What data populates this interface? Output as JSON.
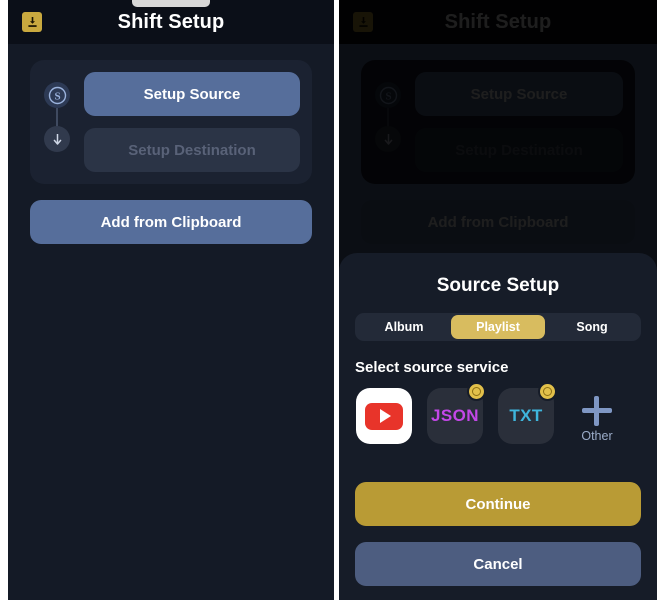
{
  "app": {
    "title": "Shift Setup",
    "import_icon": "download-tray-icon"
  },
  "setup": {
    "source_node_icon": "source-circle-s-icon",
    "destination_node_icon": "arrow-down-circle-icon",
    "source_button": "Setup Source",
    "destination_button": "Setup Destination",
    "clipboard_button": "Add from Clipboard"
  },
  "sheet": {
    "title": "Source Setup",
    "segments": [
      {
        "label": "Album",
        "active": false
      },
      {
        "label": "Playlist",
        "active": true
      },
      {
        "label": "Song",
        "active": false
      }
    ],
    "section_label": "Select source service",
    "services": [
      {
        "label": "",
        "kind": "youtube",
        "badge": false,
        "icon": "youtube-icon"
      },
      {
        "label": "JSON",
        "kind": "json",
        "badge": true,
        "icon": "json-file-icon"
      },
      {
        "label": "TXT",
        "kind": "txt",
        "badge": true,
        "icon": "txt-file-icon"
      }
    ],
    "other": {
      "label": "Other",
      "icon": "plus-icon"
    },
    "continue_button": "Continue",
    "cancel_button": "Cancel"
  },
  "colors": {
    "accent_gold": "#d8bc5f",
    "continue_gold": "#b99b35",
    "primary_blue": "#566e9b",
    "cancel_blue": "#4d5d80",
    "screen_bg": "#141a26",
    "sheet_bg": "#161c28",
    "json_magenta": "#c447e8",
    "txt_cyan": "#3fb6dd",
    "youtube_red": "#e8342a",
    "other_blue": "#7f97c4"
  }
}
